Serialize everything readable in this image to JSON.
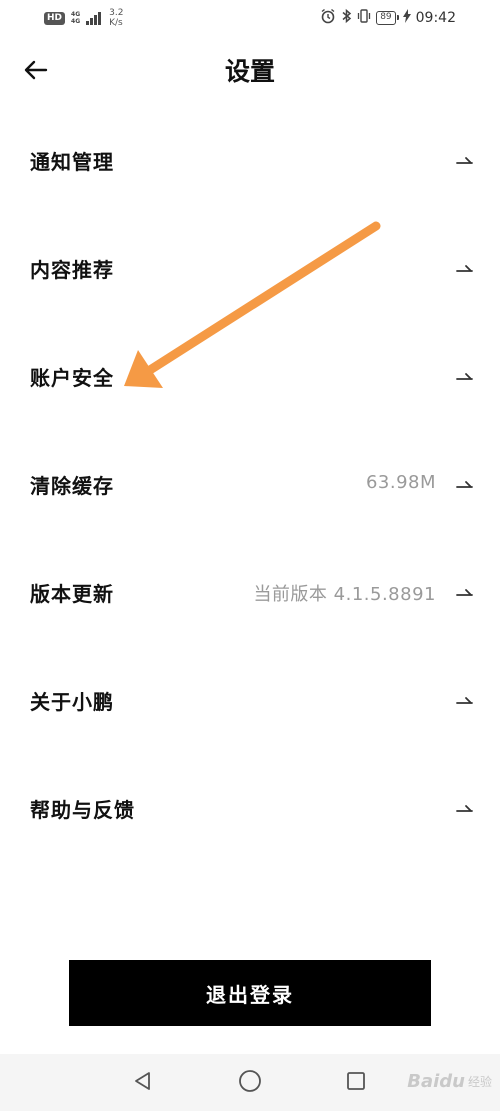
{
  "status_bar": {
    "hd_badge": "HD",
    "net_type_top": "4G",
    "net_type_bottom": "4G",
    "speed_value": "3.2",
    "speed_unit": "K/s",
    "battery": "89",
    "time": "09:42",
    "icons": [
      "alarm-icon",
      "bluetooth-icon",
      "vibrate-icon",
      "battery-icon",
      "charging-icon"
    ]
  },
  "header": {
    "title": "设置",
    "back_icon": "back-arrow-icon"
  },
  "settings": {
    "items": [
      {
        "label": "通知管理",
        "value": ""
      },
      {
        "label": "内容推荐",
        "value": ""
      },
      {
        "label": "账户安全",
        "value": ""
      },
      {
        "label": "清除缓存",
        "value": "63.98M"
      },
      {
        "label": "版本更新",
        "value": "当前版本 4.1.5.8891"
      },
      {
        "label": "关于小鹏",
        "value": ""
      },
      {
        "label": "帮助与反馈",
        "value": ""
      }
    ]
  },
  "logout": {
    "label": "退出登录"
  },
  "nav": {
    "icons": [
      "back-triangle-icon",
      "home-circle-icon",
      "recents-square-icon"
    ]
  },
  "watermark": {
    "brand": "Baidu",
    "sub": "经验"
  },
  "colors": {
    "annotation_arrow": "#f59a45",
    "logout_bg": "#000000",
    "value_text": "#9a9a9a"
  }
}
